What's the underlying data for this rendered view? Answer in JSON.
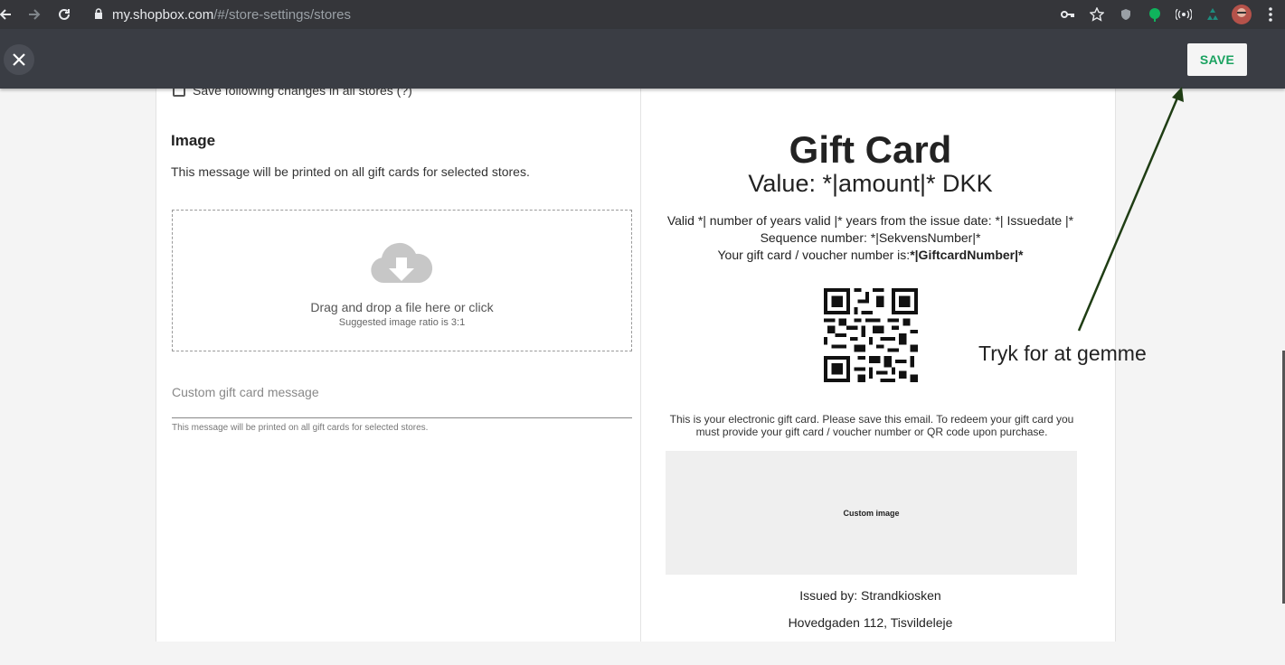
{
  "browser": {
    "url_host": "my.shopbox.com",
    "url_path": "/#/store-settings/stores"
  },
  "appbar": {
    "save_label": "SAVE"
  },
  "settings": {
    "save_all_label": "Save following changes in all stores (?)",
    "image_title": "Image",
    "image_description": "This message will be printed on all gift cards for selected stores.",
    "dropzone_main": "Drag and drop a file here or click",
    "dropzone_sub": "Suggested image ratio is 3:1",
    "message_placeholder": "Custom gift card message",
    "message_hint": "This message will be printed on all gift cards for selected stores."
  },
  "preview": {
    "title": "Gift Card",
    "value": "Value: *|amount|* DKK",
    "valid_line": "Valid *| number of years valid |* years from the issue date: *| Issuedate |*",
    "sequence_line": "Sequence number: *|SekvensNumber|*",
    "number_prefix": "Your gift card / voucher number is:",
    "number_value": "*|GiftcardNumber|*",
    "note": "This is your electronic gift card. Please save this email. To redeem your gift card you must provide your gift card / voucher number or QR code upon purchase.",
    "custom_image_label": "Custom image",
    "issued_by": "Issued by: Strandkiosken",
    "address": "Hovedgaden 112, Tisvildeleje"
  },
  "annotation": {
    "text": "Tryk for at gemme",
    "color": "#1f3d14"
  },
  "colors": {
    "save_text": "#1aa260",
    "appbar": "#3a3d44",
    "chrome": "#35363a"
  }
}
